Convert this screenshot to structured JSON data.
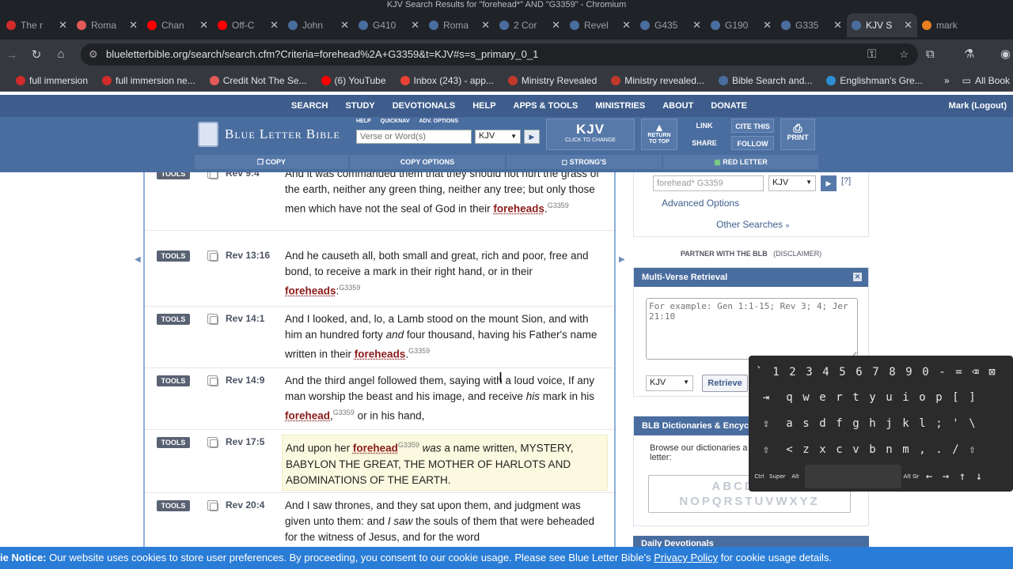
{
  "window_title": "KJV Search Results for \"forehead*\" AND \"G3359\" - Chromium",
  "tabs": [
    {
      "label": "The r",
      "color": "#d12b2b"
    },
    {
      "label": "Roma",
      "color": "#e35a5a"
    },
    {
      "label": "Chan",
      "color": "#ff0000"
    },
    {
      "label": "Off-C",
      "color": "#ff0000"
    },
    {
      "label": "John",
      "color": "#4a6d9f"
    },
    {
      "label": "G410",
      "color": "#4a6d9f"
    },
    {
      "label": "Roma",
      "color": "#4a6d9f"
    },
    {
      "label": "2 Cor",
      "color": "#4a6d9f"
    },
    {
      "label": "Revel",
      "color": "#4a6d9f"
    },
    {
      "label": "G435",
      "color": "#4a6d9f"
    },
    {
      "label": "G190",
      "color": "#4a6d9f"
    },
    {
      "label": "G335",
      "color": "#4a6d9f"
    },
    {
      "label": "KJV S",
      "color": "#4a6d9f",
      "active": true
    },
    {
      "label": "mark",
      "color": "#e67e22"
    }
  ],
  "address": {
    "url": "blueletterbible.org/search/search.cfm?Criteria=forehead%2A+G3359&t=KJV#s=s_primary_0_1"
  },
  "bookmarks": [
    {
      "label": "full immersion",
      "color": "#d12b2b"
    },
    {
      "label": "full immersion ne...",
      "color": "#d12b2b"
    },
    {
      "label": "Credit Not The Se...",
      "color": "#e35a5a"
    },
    {
      "label": "(6) YouTube",
      "color": "#ff0000"
    },
    {
      "label": "Inbox (243) - app...",
      "color": "#ea4335"
    },
    {
      "label": "Ministry Revealed",
      "color": "#c0392b"
    },
    {
      "label": "Ministry revealed...",
      "color": "#c0392b"
    },
    {
      "label": "Bible Search and...",
      "color": "#4a6d9f"
    },
    {
      "label": "Englishman's Gre...",
      "color": "#2d8fd5"
    }
  ],
  "bookmarks_more": "»",
  "all_bookmarks": "All Book",
  "site_nav": [
    "SEARCH",
    "STUDY",
    "DEVOTIONALS",
    "HELP",
    "APPS & TOOLS",
    "MINISTRIES",
    "ABOUT",
    "DONATE"
  ],
  "user": "Mark (Logout)",
  "logo_text": "Blue Letter Bible",
  "header_links": [
    "HELP",
    "QUICKNAV",
    "ADV. OPTIONS"
  ],
  "header_search_placeholder": "Verse or Word(s)",
  "header_version": "KJV",
  "kjv_box": {
    "title": "KJV",
    "sub": "CLICK TO CHANGE"
  },
  "return_top": [
    "RETURN",
    "TO TOP"
  ],
  "link_label": "LINK",
  "share_label": "SHARE",
  "cite_label": "CITE THIS",
  "follow_label": "FOLLOW",
  "print_label": "PRINT",
  "toolbar": {
    "copy": "COPY",
    "copy_options": "COPY OPTIONS",
    "strongs": "STRONG'S",
    "red_letter": "RED LETTER"
  },
  "tools_label": "TOOLS",
  "verses": [
    {
      "ref": "Rev 9:4",
      "parts": [
        [
          "t",
          "And it was commanded them that they should not hurt the grass of the earth, neither any green thing, neither any tree; but only those men which have not the seal of God in their "
        ],
        [
          "k",
          "foreheads"
        ],
        [
          "t",
          "."
        ],
        [
          "s",
          "G3359"
        ]
      ]
    },
    {
      "ref": "Rev 13:16",
      "parts": [
        [
          "t",
          "And he causeth all, both small and great, rich and poor, free and bond, to receive a mark in their right hand, or in their "
        ],
        [
          "k",
          "foreheads"
        ],
        [
          "t",
          ":"
        ],
        [
          "s",
          "G3359"
        ]
      ]
    },
    {
      "ref": "Rev 14:1",
      "parts": [
        [
          "t",
          "And I looked, and, lo, a Lamb stood on the mount Sion, and with him an hundred forty "
        ],
        [
          "i",
          "and"
        ],
        [
          "t",
          " four thousand, having his Father's name written in their "
        ],
        [
          "k",
          "foreheads"
        ],
        [
          "t",
          "."
        ],
        [
          "s",
          "G3359"
        ]
      ]
    },
    {
      "ref": "Rev 14:9",
      "parts": [
        [
          "t",
          "And the third angel followed them, saying with a loud voice, If any man worship the beast and his image, and receive "
        ],
        [
          "i",
          "his"
        ],
        [
          "t",
          " mark in his "
        ],
        [
          "k",
          "forehead"
        ],
        [
          "t",
          ","
        ],
        [
          "s",
          "G3359"
        ],
        [
          "t",
          " or in his hand,"
        ]
      ]
    },
    {
      "ref": "Rev 17:5",
      "hl": true,
      "parts": [
        [
          "t",
          "And upon her "
        ],
        [
          "k",
          "forehead"
        ],
        [
          "s",
          "G3359"
        ],
        [
          "i",
          " was"
        ],
        [
          "t",
          " a name written, MYSTERY, BABYLON THE GREAT, THE MOTHER OF HARLOTS AND ABOMINATIONS OF THE EARTH."
        ]
      ]
    },
    {
      "ref": "Rev 20:4",
      "parts": [
        [
          "t",
          "And I saw thrones, and they sat upon them, and judgment was given unto them: and "
        ],
        [
          "i",
          "I saw"
        ],
        [
          "t",
          " the souls of them that were beheaded for the witness of Jesus, and for the word"
        ]
      ]
    }
  ],
  "sidebar": {
    "search_value": "forehead* G3359",
    "version": "KJV",
    "help": "[?]",
    "advanced": "Advanced Options",
    "other": "Other Searches",
    "partner": "PARTNER WITH THE BLB",
    "disclaimer": "(DISCLAIMER)",
    "mv_title": "Multi-Verse Retrieval",
    "mv_placeholder": "For example: Gen 1:1-15; Rev 3; 4; Jer 21:10",
    "mv_version": "KJV",
    "retrieve": "Retrieve",
    "dict_title": "BLB Dictionaries & Encyc",
    "dict_text": "Browse our dictionaries a letter:",
    "alpha1": "ABCDEFG",
    "alpha2": "NOPQRSTUVWXYZ",
    "daily": "Daily Devotionals"
  },
  "cookie": {
    "lead": "ie Notice:",
    "text": " Our website uses cookies to store user preferences. By proceeding, you consent to our cookie usage. Please see Blue Letter Bible's ",
    "link": "Privacy Policy",
    "tail": " for cookie usage details."
  },
  "keyboard": {
    "row1": [
      "`",
      "1",
      "2",
      "3",
      "4",
      "5",
      "6",
      "7",
      "8",
      "9",
      "0",
      "-",
      "=",
      "⌫",
      "⊠"
    ],
    "row2": [
      "⇥",
      "q",
      "w",
      "e",
      "r",
      "t",
      "y",
      "u",
      "i",
      "o",
      "p",
      "[",
      "]"
    ],
    "row3": [
      "⇪",
      "a",
      "s",
      "d",
      "f",
      "g",
      "h",
      "j",
      "k",
      "l",
      ";",
      "'",
      "\\"
    ],
    "row4": [
      "⇧",
      "<",
      "z",
      "x",
      "c",
      "v",
      "b",
      "n",
      "m",
      ",",
      ".",
      "/",
      "⇧"
    ],
    "row5": [
      "Ctrl",
      "Super",
      "Alt",
      "",
      "Alt Gr",
      "←",
      "→",
      "↑",
      "↓"
    ]
  }
}
